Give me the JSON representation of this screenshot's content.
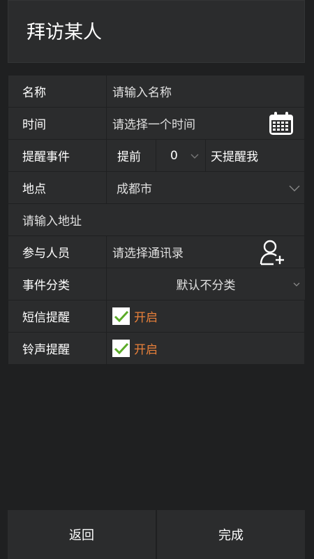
{
  "header": {
    "title": "拜访某人"
  },
  "form": {
    "name": {
      "label": "名称",
      "placeholder": "请输入名称"
    },
    "time": {
      "label": "时间",
      "placeholder": "请选择一个时间",
      "icon": "calendar-icon"
    },
    "reminder": {
      "label": "提醒事件",
      "prefix": "提前",
      "days": "0",
      "suffix": "天提醒我"
    },
    "location": {
      "label": "地点",
      "city": "成都市",
      "address_placeholder": "请输入地址"
    },
    "participants": {
      "label": "参与人员",
      "placeholder": "请选择通讯录",
      "icon": "add-contact-icon"
    },
    "category": {
      "label": "事件分类",
      "value": "默认不分类"
    },
    "sms": {
      "label": "短信提醒",
      "checked": true,
      "status": "开启"
    },
    "ringtone": {
      "label": "铃声提醒",
      "checked": true,
      "status": "开启"
    }
  },
  "actions": {
    "back": "返回",
    "done": "完成"
  },
  "colors": {
    "background": "#1f2021",
    "panel": "#2b2c2d",
    "accent_orange": "#e8803a",
    "check_green": "#5bab28"
  }
}
